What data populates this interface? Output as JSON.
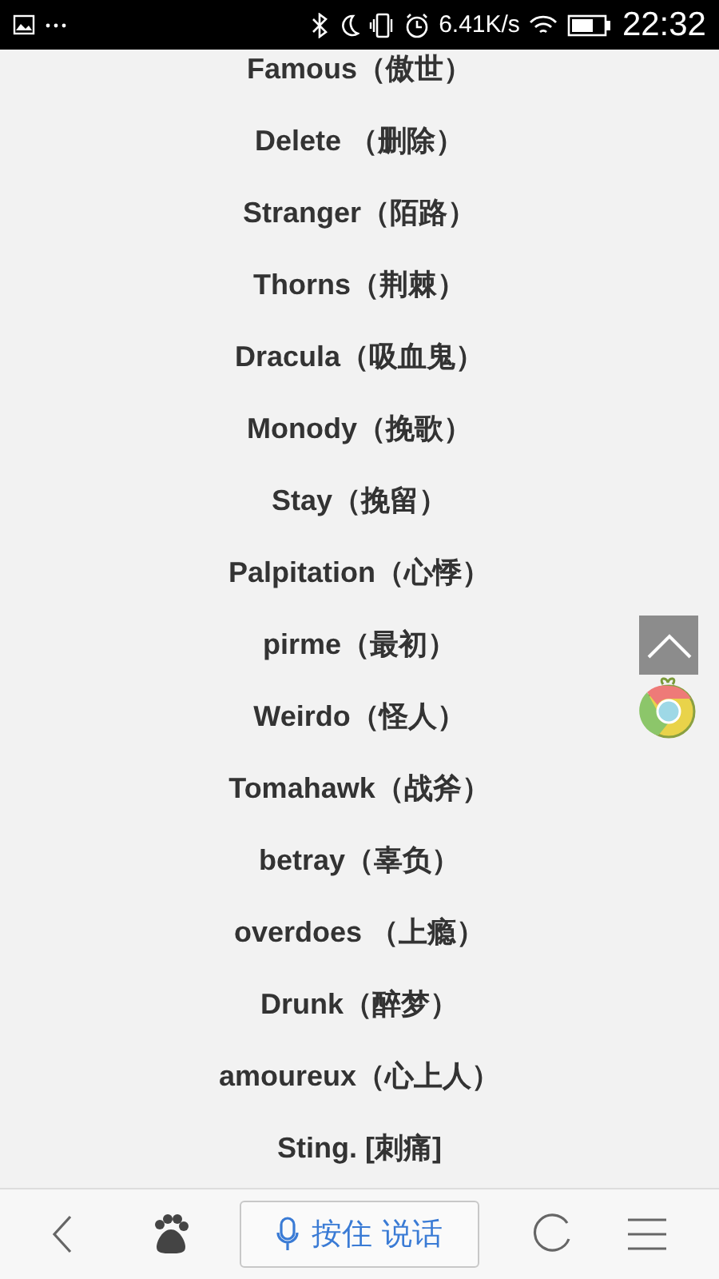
{
  "status_bar": {
    "net_speed": "6.41K/s",
    "time": "22:32"
  },
  "words": [
    {
      "text": "Famous（傲世）"
    },
    {
      "text": "Delete （删除）"
    },
    {
      "text": "Stranger（陌路）"
    },
    {
      "text": "Thorns（荆棘）"
    },
    {
      "text": "Dracula（吸血鬼）"
    },
    {
      "text": "Monody（挽歌）"
    },
    {
      "text": "Stay（挽留）"
    },
    {
      "text": "Palpitation（心悸）"
    },
    {
      "text": "pirme（最初）"
    },
    {
      "text": "Weirdo（怪人）"
    },
    {
      "text": "Tomahawk（战斧）"
    },
    {
      "text": "betray（辜负）"
    },
    {
      "text": "overdoes （上瘾）"
    },
    {
      "text": "Drunk（醉梦）"
    },
    {
      "text": "amoureux（心上人）"
    },
    {
      "text": "Sting. [刺痛]"
    }
  ],
  "bottom_bar": {
    "voice_button": "按住 说话"
  }
}
